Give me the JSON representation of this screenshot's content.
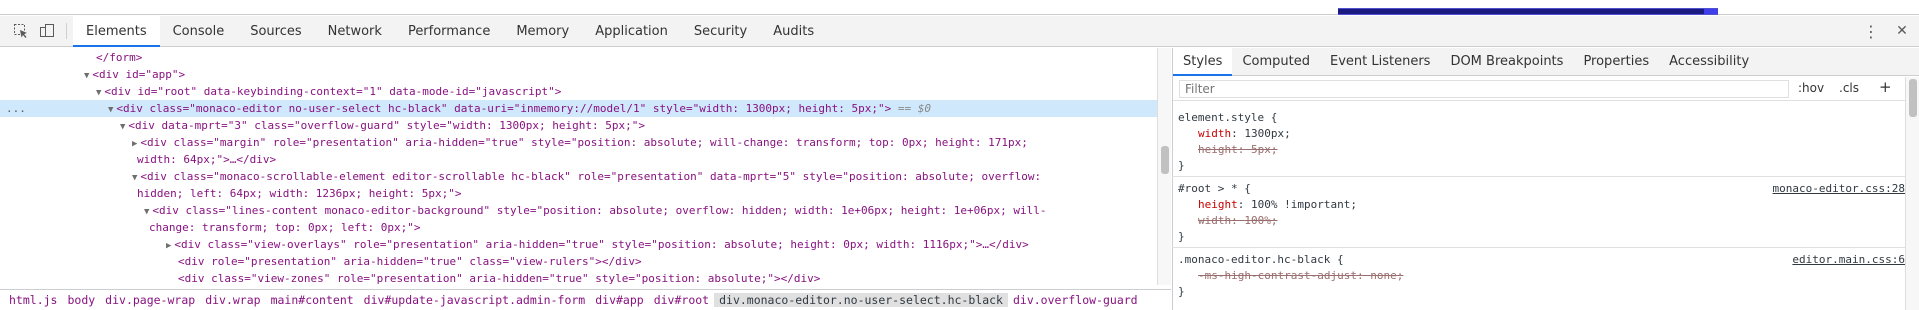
{
  "toolbar": {
    "tabs": [
      "Elements",
      "Console",
      "Sources",
      "Network",
      "Performance",
      "Memory",
      "Application",
      "Security",
      "Audits"
    ],
    "kebab": "⋮",
    "close": "✕"
  },
  "elements": {
    "ellipsis_marker": "...",
    "selected_suffix": "== $0",
    "lines": [
      {
        "text": "</form>"
      },
      {
        "text": "<div id=\"app\">"
      },
      {
        "text": "<div id=\"root\" data-keybinding-context=\"1\" data-mode-id=\"javascript\">"
      },
      {
        "text": "<div class=\"monaco-editor no-user-select  hc-black\" data-uri=\"inmemory://model/1\" style=\"width: 1300px; height: 5px;\">"
      },
      {
        "text": "<div data-mprt=\"3\" class=\"overflow-guard\" style=\"width: 1300px; height: 5px;\">"
      },
      {
        "text": "<div class=\"margin\" role=\"presentation\" aria-hidden=\"true\" style=\"position: absolute; will-change: transform; top: 0px; height: 171px;"
      },
      {
        "text": "width: 64px;\">…</div>"
      },
      {
        "text": "<div class=\"monaco-scrollable-element editor-scrollable hc-black\" role=\"presentation\" data-mprt=\"5\" style=\"position: absolute; overflow:"
      },
      {
        "text": "hidden; left: 64px; width: 1236px; height: 5px;\">"
      },
      {
        "text": "<div class=\"lines-content monaco-editor-background\" style=\"position: absolute; overflow: hidden; width: 1e+06px; height: 1e+06px; will-"
      },
      {
        "text": "change: transform; top: 0px; left: 0px;\">"
      },
      {
        "text": "<div class=\"view-overlays\" role=\"presentation\" aria-hidden=\"true\" style=\"position: absolute; height: 0px; width: 1116px;\">…</div>"
      },
      {
        "text": "<div role=\"presentation\" aria-hidden=\"true\" class=\"view-rulers\"></div>"
      },
      {
        "text": "<div class=\"view-zones\" role=\"presentation\" aria-hidden=\"true\" style=\"position: absolute;\"></div>"
      }
    ]
  },
  "breadcrumbs": [
    "html.js",
    "body",
    "div.page-wrap",
    "div.wrap",
    "main#content",
    "div#update-javascript.admin-form",
    "div#app",
    "div#root",
    "div.monaco-editor.no-user-select.hc-black",
    "div.overflow-guard"
  ],
  "styles": {
    "tabs": [
      "Styles",
      "Computed",
      "Event Listeners",
      "DOM Breakpoints",
      "Properties",
      "Accessibility"
    ],
    "filter_placeholder": "Filter",
    "hov": ":hov",
    "cls": ".cls",
    "plus": "+",
    "rules": [
      {
        "selector": "element.style {",
        "source": "",
        "props": [
          {
            "name": "width",
            "value": "1300px;",
            "struck": false
          },
          {
            "name": "height",
            "value": "5px;",
            "struck": true
          }
        ]
      },
      {
        "selector": "#root > * {",
        "source": "monaco-editor.css:28",
        "props": [
          {
            "name": "height",
            "value": "100% !important;",
            "struck": false
          },
          {
            "name": "width",
            "value": "100%;",
            "struck": true
          }
        ]
      },
      {
        "selector": ".monaco-editor.hc-black {",
        "source": "editor.main.css:6",
        "props": [
          {
            "name": "-ms-high-contrast-adjust",
            "value": "none;",
            "struck": true
          }
        ]
      }
    ],
    "close_brace": "}"
  }
}
